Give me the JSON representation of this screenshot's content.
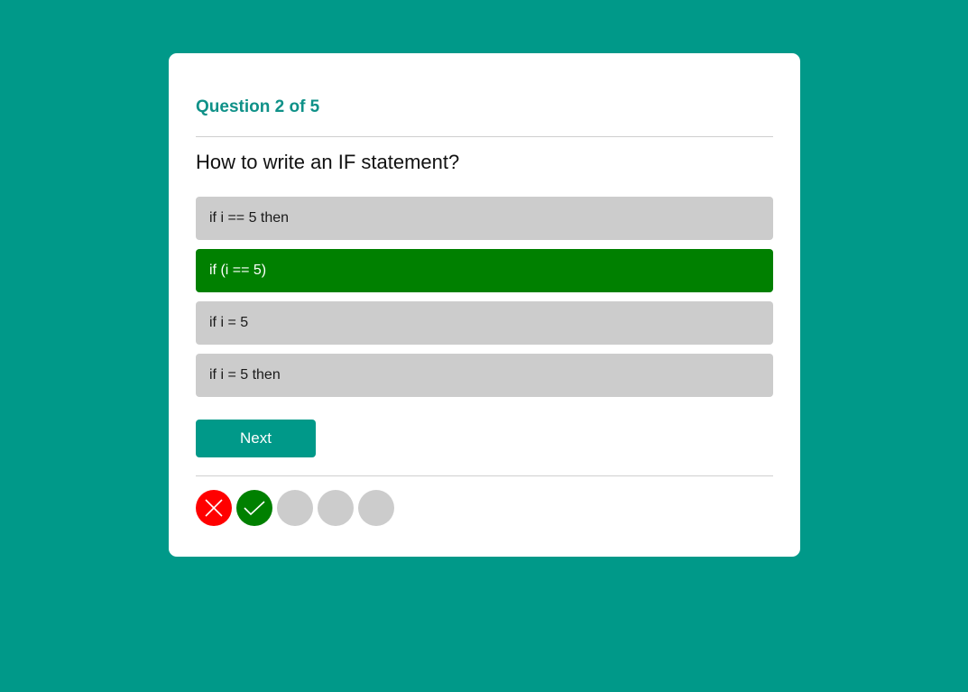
{
  "quiz": {
    "counter": "Question 2 of 5",
    "question": "How to write an IF statement?",
    "answers": [
      {
        "label": "if i == 5 then",
        "state": "default"
      },
      {
        "label": "if (i == 5)",
        "state": "correct"
      },
      {
        "label": "if i = 5",
        "state": "default"
      },
      {
        "label": "if i = 5 then",
        "state": "default"
      }
    ],
    "next_label": "Next",
    "progress": [
      "wrong",
      "right",
      "pending",
      "pending",
      "pending"
    ]
  },
  "colors": {
    "background": "#009989",
    "card": "#ffffff",
    "accent_text": "#0f9188",
    "answer_default": "#cccccc",
    "answer_correct": "#008000",
    "progress_wrong": "#ff0000",
    "progress_right": "#008000",
    "progress_pending": "#cccccc"
  },
  "icons": {
    "wrong": "close-icon",
    "right": "checkmark-icon"
  }
}
